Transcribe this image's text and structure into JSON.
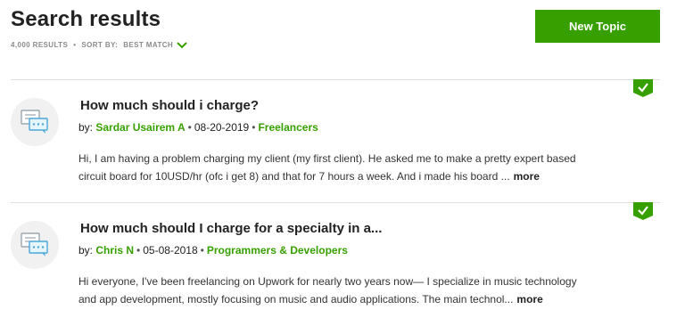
{
  "header": {
    "title": "Search results",
    "results_count": "4,000 RESULTS",
    "separator": "•",
    "sort_label": "SORT BY:",
    "sort_value": "BEST MATCH",
    "new_topic_label": "New Topic"
  },
  "colors": {
    "accent": "#37a000",
    "text": "#222222",
    "muted": "#8a8a8a"
  },
  "results": [
    {
      "title_match": "How much should i charge?",
      "title_rest": "",
      "by_label": "by:",
      "author": "Sardar Usairem A",
      "date": "08-20-2019",
      "forum": "Freelancers",
      "snippet_line1": "Hi, I am having a problem charging my client (my first client). He asked me to make a pretty expert based",
      "snippet_line2": "circuit board for 10USD/hr (ofc i get 8) and that for 7 hours a week. And i made his board ...",
      "more": "more",
      "badge_icon": "check-badge-icon"
    },
    {
      "title_match": "How much should I charge",
      "title_rest": "for a specialty in a...",
      "by_label": "by:",
      "author": "Chris N",
      "date": "05-08-2018",
      "forum": "Programmers & Developers",
      "snippet_line1": "Hi everyone,   I've been freelancing on Upwork for nearly two years now— I specialize in music technology",
      "snippet_line2": "and app development, mostly focusing on music and audio applications.    The main technol...",
      "more": "more",
      "badge_icon": "check-badge-icon"
    }
  ],
  "bullet": "•"
}
